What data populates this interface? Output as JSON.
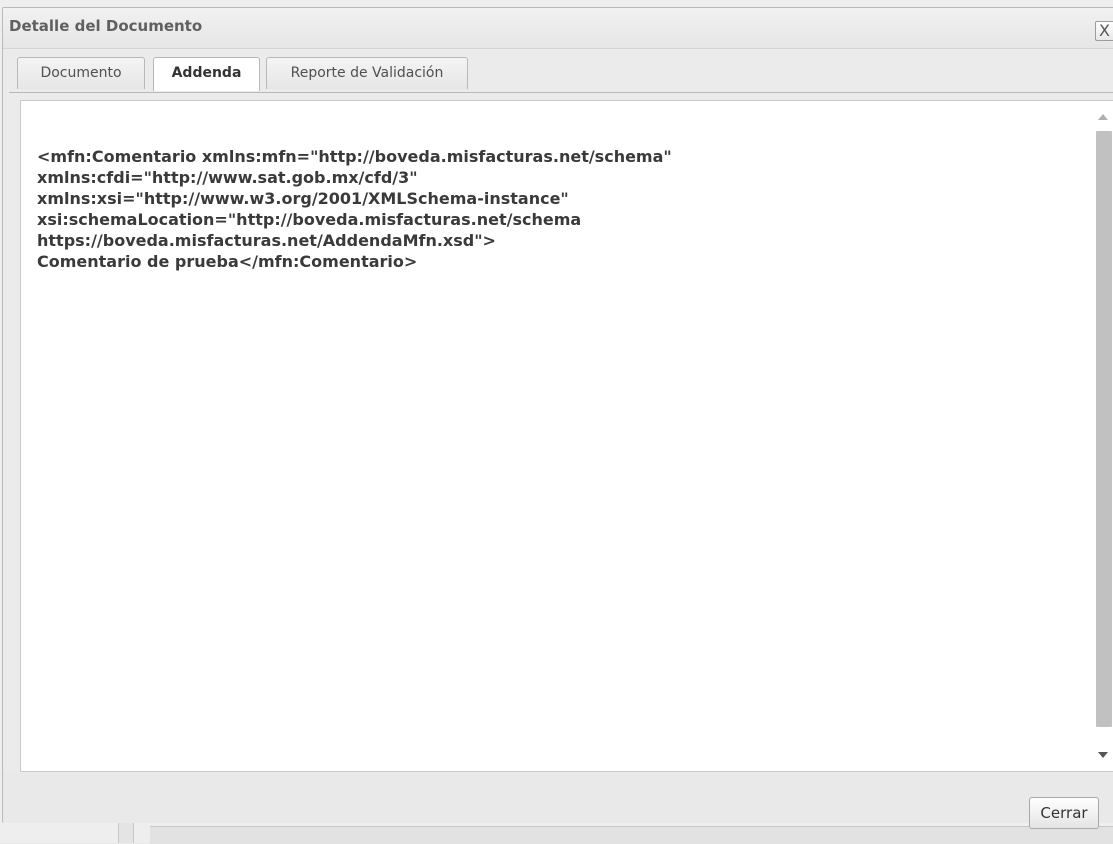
{
  "dialog": {
    "title": "Detalle del Documento",
    "close_glyph": "X"
  },
  "tabs": [
    {
      "label": "Documento",
      "active": false
    },
    {
      "label": "Addenda",
      "active": true
    },
    {
      "label": "Reporte de Validación",
      "active": false
    }
  ],
  "content": {
    "lines": [
      "<mfn:Comentario xmlns:mfn=\"http://boveda.misfacturas.net/schema\"",
      "xmlns:cfdi=\"http://www.sat.gob.mx/cfd/3\"",
      "xmlns:xsi=\"http://www.w3.org/2001/XMLSchema-instance\"",
      "xsi:schemaLocation=\"http://boveda.misfacturas.net/schema",
      "https://boveda.misfacturas.net/AddendaMfn.xsd\">",
      "Comentario de prueba</mfn:Comentario>"
    ]
  },
  "footer": {
    "close_label": "Cerrar"
  },
  "colors": {
    "title_text": "#606060",
    "content_text": "#3a3a3a",
    "panel_bg": "#ebebeb"
  },
  "icons": {
    "close": "close-icon",
    "scroll_up": "scroll-up-arrow-icon",
    "scroll_down": "scroll-down-arrow-icon"
  }
}
